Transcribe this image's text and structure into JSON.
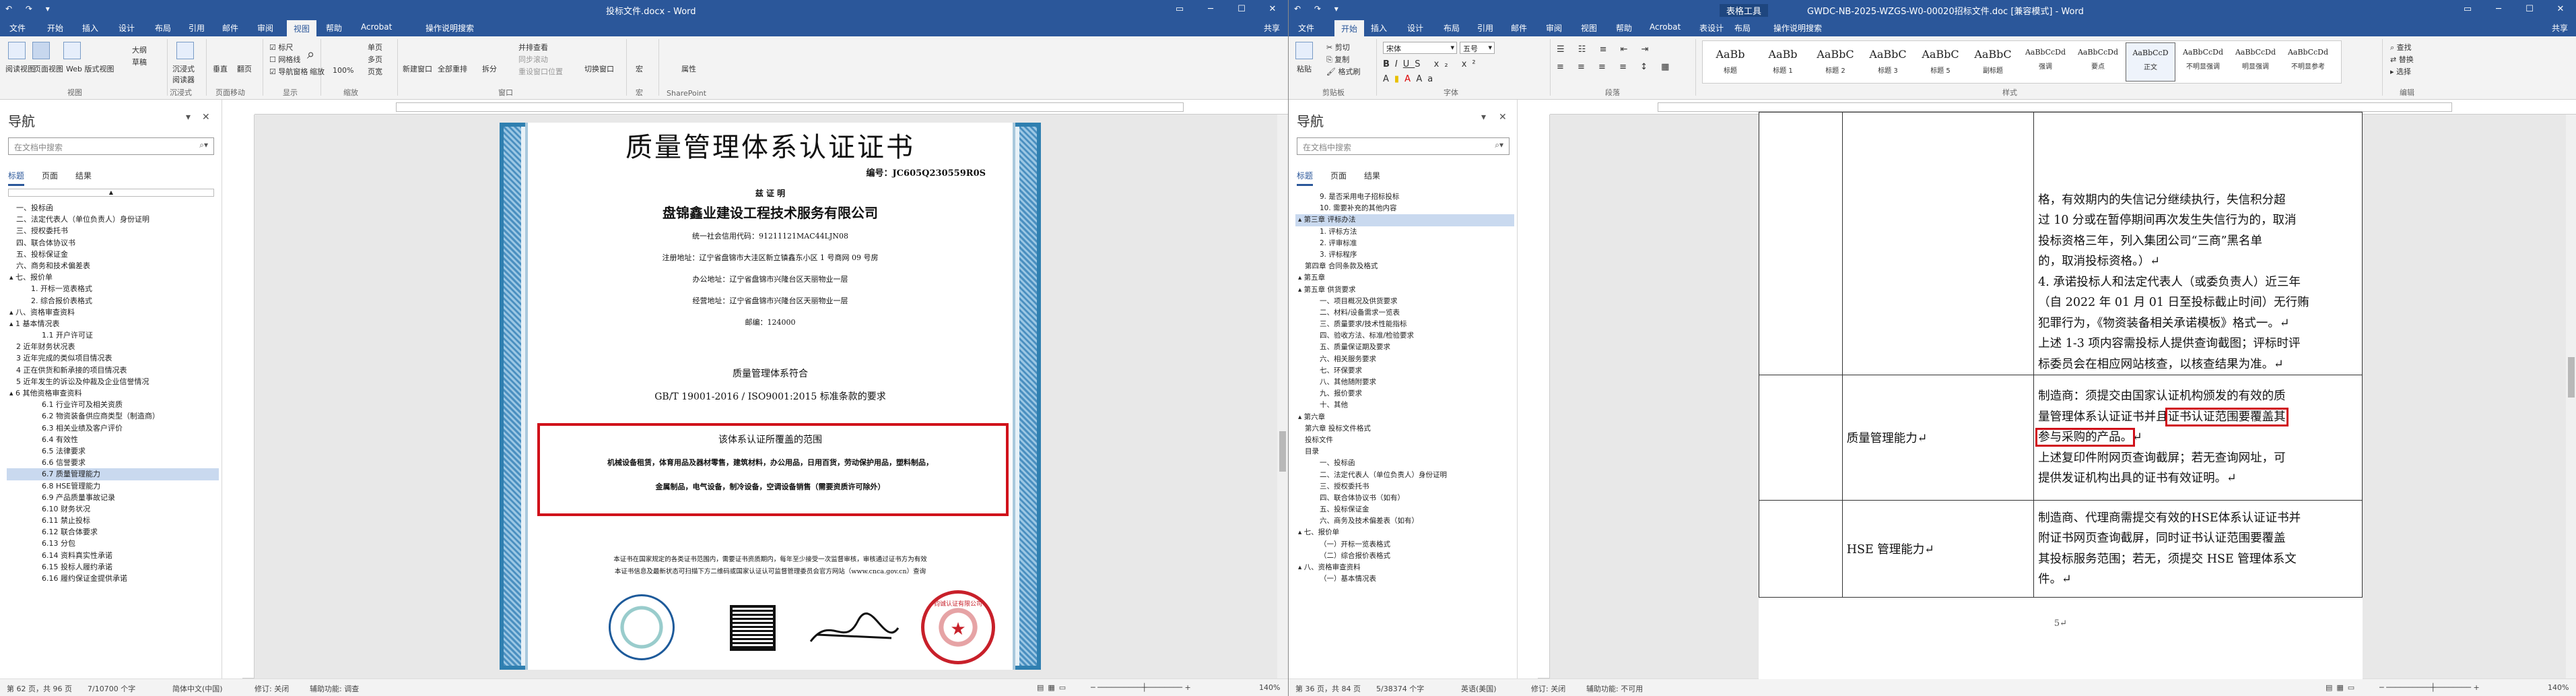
{
  "left": {
    "title": "投标文件.docx - Word",
    "quick_access": "↶ ↷ ▾",
    "share": "共享",
    "tabs": [
      "文件",
      "开始",
      "插入",
      "设计",
      "布局",
      "引用",
      "邮件",
      "审阅",
      "视图",
      "帮助",
      "Acrobat"
    ],
    "active_tab": "视图",
    "tell_me": "操作说明搜索",
    "ribbon": {
      "views": [
        "阅读视图",
        "页面视图",
        "Web 版式视图"
      ],
      "views_more": [
        "大纲",
        "草稿"
      ],
      "immersive": "沉浸式阅读器",
      "page_move": [
        "垂直",
        "翻页"
      ],
      "show": [
        "标尺",
        "网格线",
        "导航窗格"
      ],
      "zoom": [
        "缩放",
        "100%"
      ],
      "zoom_more": [
        "单页",
        "多页",
        "页宽"
      ],
      "window": [
        "新建窗口",
        "全部重排",
        "拆分"
      ],
      "side_by_side": [
        "并排查看",
        "同步滚动",
        "重设窗口位置"
      ],
      "switch_window": "切换窗口",
      "macro": "宏",
      "properties": "属性",
      "group_names": [
        "视图",
        "沉浸式",
        "页面移动",
        "显示",
        "缩放",
        "窗口",
        "宏",
        "SharePoint"
      ]
    },
    "nav": {
      "title": "导航",
      "search_placeholder": "在文档中搜索",
      "tabs": [
        "标题",
        "页面",
        "结果"
      ],
      "items": [
        "一、投标函",
        "二、法定代表人（单位负责人）身份证明",
        "三、授权委托书",
        "四、联合体协议书",
        "五、投标保证金",
        "六、商务和技术偏差表",
        "▴ 七、报价单",
        "1. 开标一览表格式",
        "2. 综合报价表格式",
        "▴ 八、资格审查资料",
        "▴ 1 基本情况表",
        "1.1 开户许可证",
        "2 近年财务状况表",
        "3 近年完成的类似项目情况表",
        "4 正在供货和新承接的项目情况表",
        "5 近年发生的诉讼及仲裁及企业信誉情况",
        "▴ 6 其他资格审查资料",
        "6.1 行业许可及相关资质",
        "6.2 物资装备供应商类型（制造商）",
        "6.3 相关业绩及客户评价",
        "6.4 有效性",
        "6.5 法律要求",
        "6.6 信誉要求",
        "6.7 质量管理能力",
        "6.8 HSE管理能力",
        "6.9 产品质量事故记录",
        "6.10 财务状况",
        "6.11 禁止投标",
        "6.12 联合体要求",
        "6.13 分包",
        "6.14 资料真实性承诺",
        "6.15 投标人履约承诺",
        "6.16 履约保证金提供承诺"
      ],
      "selected_index": 23
    },
    "certificate": {
      "title": "质量管理体系认证证书",
      "number": "编号：JC605Q230559R0S",
      "certify": "兹 证 明",
      "company": "盘锦鑫业建设工程技术服务有限公司",
      "credit_code": "统一社会信用代码：91211121MAC44LJN08",
      "reg_address": "注册地址：辽宁省盘锦市大洼区新立镇鑫东小区 1 号商网 09 号房",
      "office_address": "办公地址：辽宁省盘锦市兴隆台区天丽物业一层",
      "business_address": "经营地址：辽宁省盘锦市兴隆台区天丽物业一层",
      "postcode": "邮编：124000",
      "conforms": "质量管理体系符合",
      "standard": "GB/T 19001-2016 / ISO9001:2015 标准条款的要求",
      "scope_title": "该体系认证所覆盖的范围",
      "scope_l1": "机械设备租赁，体育用品及器材零售，建筑材料，办公用品，日用百货，劳动保护用品，塑料制品，",
      "scope_l2": "金属制品，电气设备，制冷设备，空调设备销售（需要资质许可除外）",
      "note1": "本证书在国家规定的各类证书范围内，需要证书资质期内，每年至少接受一次监督审核，审核通过证书方为有效",
      "note2": "本证书信息及最新状态可扫描下方二维码或国家认证认可监督管理委员会官方网站（www.cnca.gov.cn）查询",
      "seal_right": "钧诚认证有限公司"
    },
    "status": [
      "第 62 页，共 96 页",
      "7/10700 个字",
      "简体中文(中国)",
      "修订: 关闭",
      "辅助功能: 调查"
    ],
    "zoom": "140%"
  },
  "right": {
    "title": "GWDC-NB-2025-WZGS-W0-00020招标文件.doc [兼容模式] - Word",
    "table_tools": "表格工具",
    "quick_access": "↶ ↷ ▾",
    "share": "共享",
    "tabs": [
      "文件",
      "开始",
      "插入",
      "设计",
      "布局",
      "引用",
      "邮件",
      "审阅",
      "视图",
      "帮助",
      "Acrobat",
      "表设计",
      "布局"
    ],
    "active_tab": "开始",
    "tell_me": "操作说明搜索",
    "ribbon": {
      "paste": "粘贴",
      "clipboard": [
        "剪切",
        "复制",
        "格式刷"
      ],
      "font_name": "宋体",
      "font_size": "五号",
      "styles": [
        [
          "AaBb",
          "标题"
        ],
        [
          "AaBb",
          "标题 1"
        ],
        [
          "AaBbC",
          "标题 2"
        ],
        [
          "AaBbC",
          "标题 3"
        ],
        [
          "AaBbC",
          "标题 5"
        ],
        [
          "AaBbC",
          "副标题"
        ],
        [
          "AaBbCcDd",
          "强调"
        ],
        [
          "AaBbCcDd",
          "要点"
        ],
        [
          "AaBbCcD",
          "正文"
        ],
        [
          "AaBbCcDd",
          "不明显强调"
        ],
        [
          "AaBbCcDd",
          "明显强调"
        ],
        [
          "AaBbCcDd",
          "不明显参考"
        ]
      ],
      "editing": [
        "查找",
        "替换",
        "选择"
      ],
      "group_names": [
        "剪贴板",
        "字体",
        "段落",
        "样式",
        "编辑"
      ]
    },
    "nav": {
      "title": "导航",
      "search_placeholder": "在文档中搜索",
      "tabs": [
        "标题",
        "页面",
        "结果"
      ],
      "items": [
        "9. 是否采用电子招标投标",
        "10. 需要补充的其他内容",
        "▴ 第三章  评标办法",
        "1. 评标方法",
        "2. 评审标准",
        "3. 评标程序",
        "第四章  合同条款及格式",
        "▴ 第五章",
        "▴ 第五章  供货要求",
        "一、项目概况及供货要求",
        "二、材料/设备需求一览表",
        "三、质量要求/技术性能指标",
        "四、验收方法、标准/检验要求",
        "五、质量保证期及要求",
        "六、相关服务要求",
        "七、环保要求",
        "八、其他随附要求",
        "九、报价要求",
        "十、其他",
        "▴ 第六章",
        "第六章  投标文件格式",
        "投标文件",
        "目录",
        "一、投标函",
        "二、法定代表人（单位负责人）身份证明",
        "三、授权委托书",
        "四、联合体协议书（如有）",
        "五、投标保证金",
        "六、商务及技术偏差表（如有）",
        "▴ 七、报价单",
        "（一）开标一览表格式",
        "（二）综合报价表格式",
        "▴ 八、资格审查资料",
        "（一）基本情况表"
      ],
      "selected_index": 2
    },
    "table": {
      "top_lines": [
        "格，有效期内的失信记分继续执行，失信积分超",
        "过 10 分或在暂停期间再次发生失信行为的，取消",
        "投标资格三年，列入集团公司“三商”黑名单",
        "的，取消投标资格。）↵",
        "4. 承诺投标人和法定代表人（或委负责人）近三年",
        "（自 2022 年 01 月 01 日至投标截止时间）无行贿",
        "犯罪行为，《物资装备相关承诺模板》格式一。↵",
        "上述 1-3 项内容需投标人提供查询截图；评标时评",
        "标委员会在相应网站核查，以核查结果为准。↵"
      ],
      "row_quality_label": "质量管理能力↵",
      "quality_lines": [
        "制造商：须提交由国家认证机构颁发的有效的质",
        "量管理体系认证证书并且",
        "证书认证范围要覆盖其",
        "参与采购的产品。",
        "↵",
        "上述复印件附网页查询截屏；若无查询网址，可",
        "提供发证机构出具的证书有效证明。↵"
      ],
      "row_hse_label": "HSE 管理能力↵",
      "hse_lines": [
        "制造商、代理商需提交有效的HSE体系认证证书并",
        "附证书网页查询截屏，同时证书认证范围要覆盖",
        "其投标服务范围；若无，须提交 HSE 管理体系文",
        "件。↵"
      ],
      "page_number": "5↵"
    },
    "status": [
      "第 36 页，共 84 页",
      "5/38374 个字",
      "英语(美国)",
      "修订: 关闭",
      "辅助功能: 不可用"
    ],
    "zoom": "140%"
  }
}
